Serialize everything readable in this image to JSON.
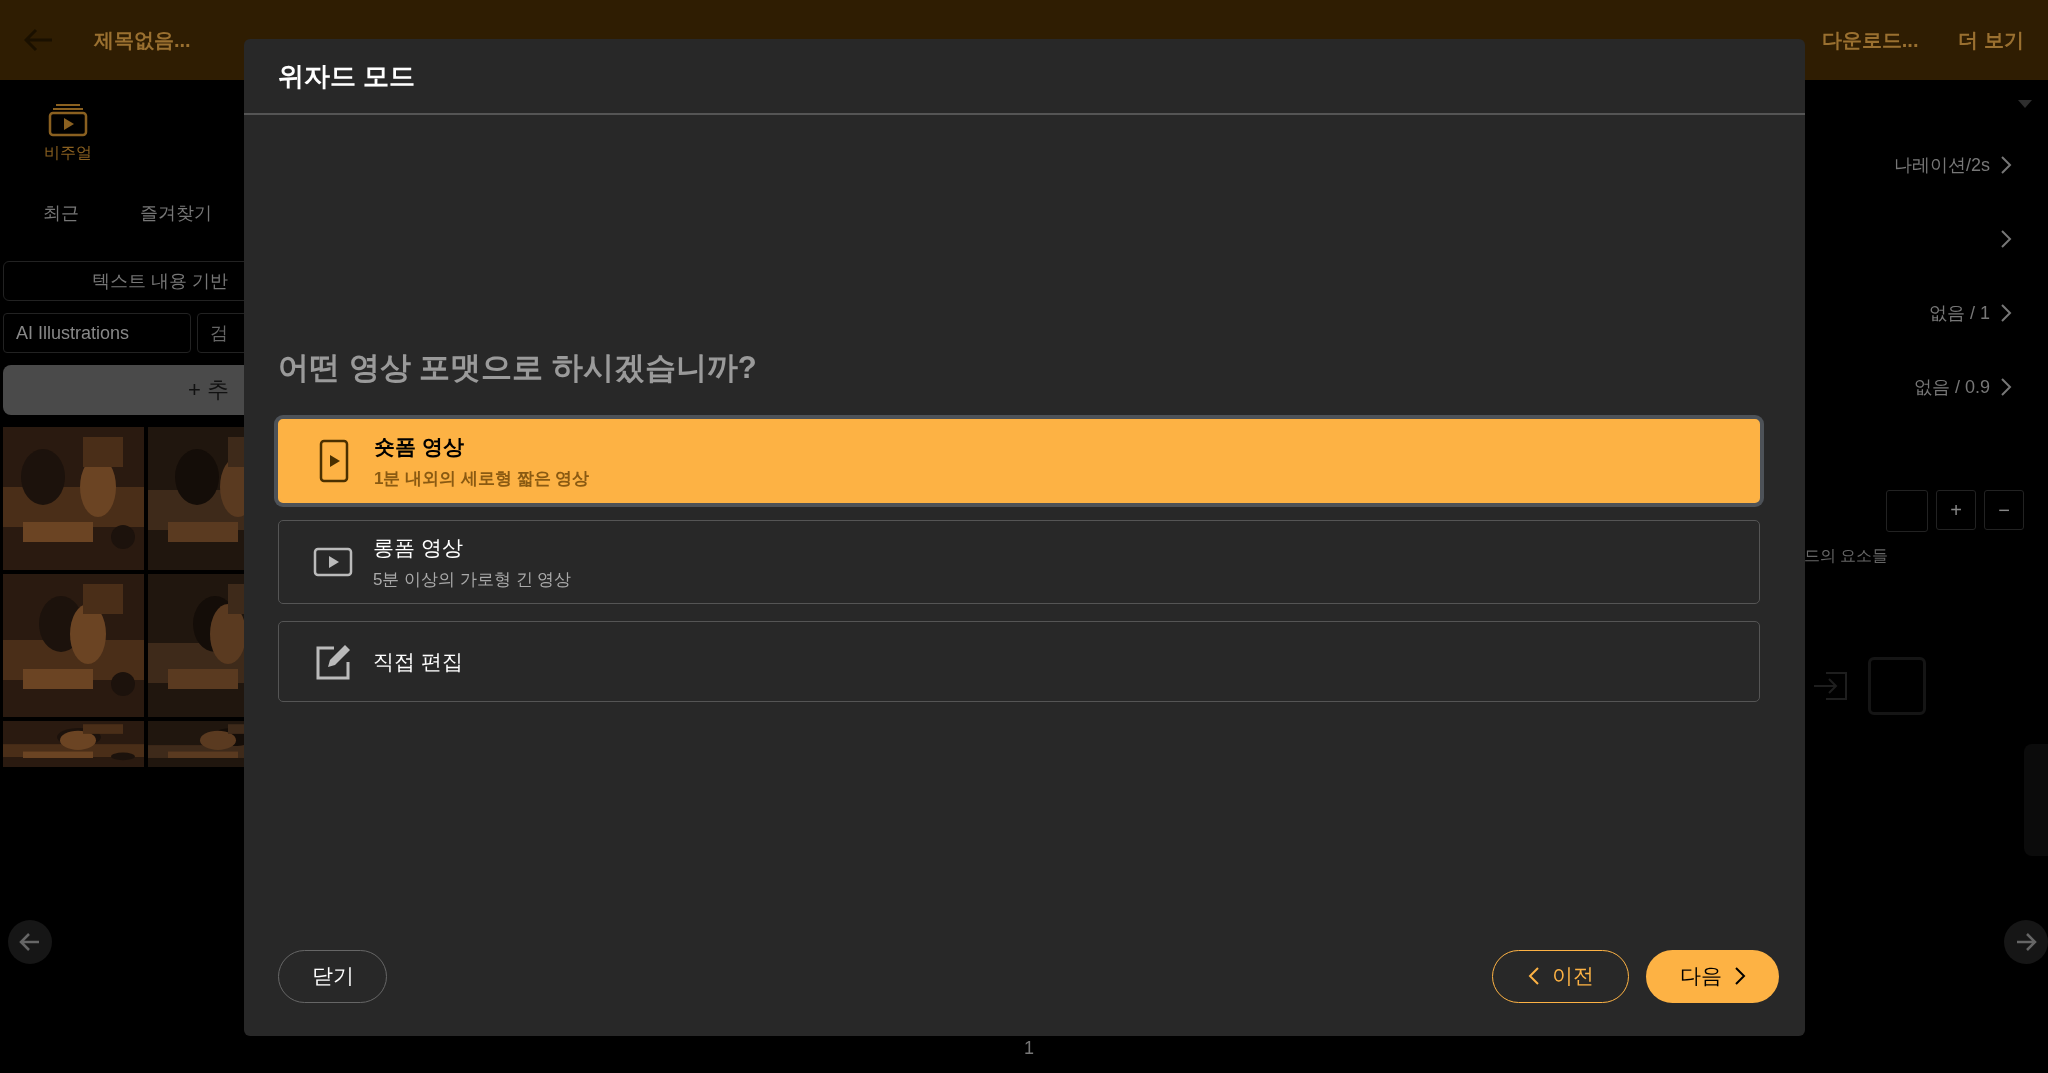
{
  "top_bar": {
    "title": "제목없음...",
    "download": "다운로드...",
    "more": "더 보기"
  },
  "left_panel": {
    "tabs": [
      {
        "label": "비주얼",
        "selected": true
      }
    ],
    "filters": [
      "최근",
      "즐겨찾기"
    ],
    "prompt_button": "텍스트 내용 기반",
    "source": "AI Illustrations",
    "search_placeholder": "검",
    "add_button": "+ 추",
    "pictures": [
      {
        "kind": "picture"
      },
      {
        "kind": "picture"
      },
      {
        "kind": "picture"
      },
      {
        "kind": "picture"
      },
      {
        "kind": "picture"
      },
      {
        "kind": "picture"
      }
    ]
  },
  "right_panel": {
    "rows": [
      {
        "value": "나레이션/2s"
      },
      {
        "value": null
      },
      {
        "value": "없음 / 1"
      },
      {
        "value": "없음 / 0.9"
      }
    ],
    "zoom_in": "+",
    "zoom_out": "−",
    "section": "드의 요소들"
  },
  "page_number": "1",
  "dialog": {
    "title": "위자드 모드",
    "question": "어떤 영상 포맷으로 하시겠습니까?",
    "options": [
      {
        "kind": "portrait-video",
        "title": "숏폼 영상",
        "subtitle": "1분 내외의 세로형 짧은 영상",
        "selected": true
      },
      {
        "kind": "landscape-video",
        "title": "롱폼 영상",
        "subtitle": "5분 이상의 가로형 긴 영상",
        "selected": false
      },
      {
        "kind": "edit",
        "title": "직접 편집",
        "selected": false
      }
    ],
    "close_button": "닫기",
    "prev_button": "이전",
    "next_button": "다음"
  }
}
